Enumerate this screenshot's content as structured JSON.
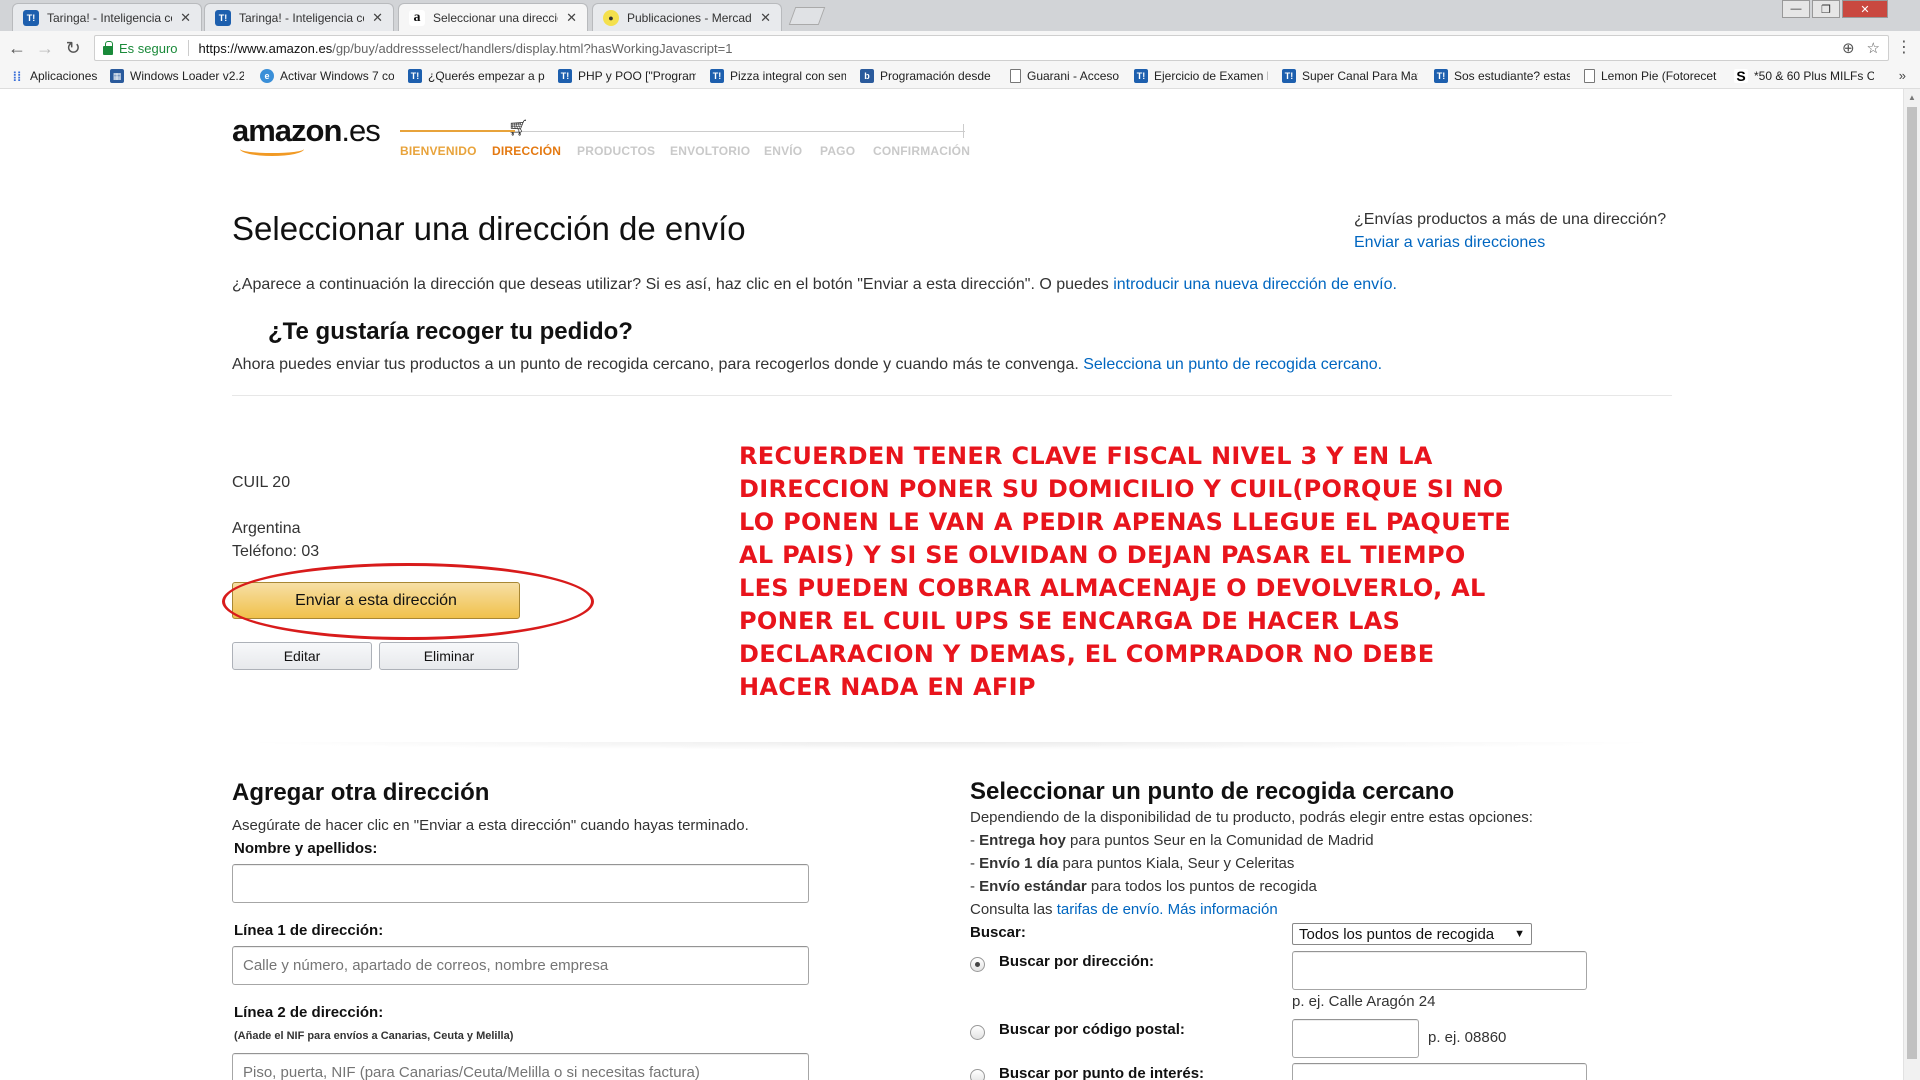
{
  "browser": {
    "tabs": [
      {
        "title": "Taringa! - Inteligencia co",
        "icon": "T!"
      },
      {
        "title": "Taringa! - Inteligencia co",
        "icon": "T!"
      },
      {
        "title": "Seleccionar una dirección",
        "icon": "a"
      },
      {
        "title": "Publicaciones - Mercado",
        "icon": "mercadolibre"
      }
    ],
    "secure_label": "Es seguro",
    "url_host": "https://www.amazon.es",
    "url_path": "/gp/buy/addressselect/handlers/display.html?hasWorkingJavascript=1",
    "bookmarks": [
      "Aplicaciones",
      "Windows Loader v2.2",
      "Activar Windows 7 co",
      "¿Querés empezar a p",
      "PHP y POO [\"Program",
      "Pizza integral con sem",
      "Programación desde",
      "Guarani - Acceso",
      "Ejercicio de Examen F",
      "Super Canal Para Mat",
      "Sos estudiante? estas",
      "Lemon Pie (Fotorecet",
      "*50 & 60 Plus MILFs C"
    ],
    "bookmarks_more": "»"
  },
  "checkout": {
    "logo_text": "amazon",
    "logo_tld": ".es",
    "steps": [
      "BIENVENIDO",
      "DIRECCIÓN",
      "PRODUCTOS",
      "ENVOLTORIO",
      "ENVÍO",
      "PAGO",
      "CONFIRMACIÓN"
    ],
    "accent": "#e47911"
  },
  "main": {
    "title": "Seleccionar una dirección de envío",
    "multi_question": "¿Envías productos a más de una dirección?",
    "multi_link": "Enviar a varias direcciones",
    "intro_text": "¿Aparece a continuación la dirección que deseas utilizar? Si es así, haz clic en el botón \"Enviar a esta dirección\". O puedes ",
    "intro_link": "introducir una nueva dirección de envío.",
    "pickup_heading": "¿Te gustaría recoger tu pedido?",
    "pickup_text": "Ahora puedes enviar tus productos a un punto de recogida cercano, para recogerlos donde y cuando más te convenga. ",
    "pickup_link": "Selecciona un punto de recogida cercano."
  },
  "address": {
    "line1": "CUIL 20",
    "country": "Argentina",
    "phone": "Teléfono: 03",
    "ship_button": "Enviar a esta dirección",
    "edit_button": "Editar",
    "delete_button": "Eliminar"
  },
  "annotation": {
    "text": "RECUERDEN TENER CLAVE FISCAL NIVEL 3 Y EN LA DIRECCION PONER SU DOMICILIO Y CUIL(PORQUE SI NO LO PONEN LE VAN A PEDIR APENAS LLEGUE EL PAQUETE AL PAIS) Y SI SE OLVIDAN O DEJAN PASAR EL TIEMPO LES PUEDEN COBRAR ALMACENAJE O DEVOLVERLO, AL PONER EL CUIL UPS SE ENCARGA DE HACER LAS DECLARACION Y DEMAS, EL COMPRADOR NO DEBE HACER NADA EN AFIP",
    "color": "#e8141c"
  },
  "add_address": {
    "heading": "Agregar otra dirección",
    "subtitle": "Asegúrate de hacer clic en \"Enviar a esta dirección\" cuando hayas terminado.",
    "name_label": "Nombre y apellidos:",
    "name_value": "",
    "line1_label": "Línea 1 de dirección:",
    "line1_placeholder": "Calle y número, apartado de correos, nombre empresa",
    "line2_label": "Línea 2 de dirección:",
    "line2_hint": "(Añade el NIF para envíos a Canarias, Ceuta y Melilla)",
    "line2_placeholder": "Piso, puerta, NIF (para Canarias/Ceuta/Melilla o si necesitas factura)"
  },
  "pickup_point": {
    "heading": "Seleccionar un punto de recogida cercano",
    "desc": "Dependiendo de la disponibilidad de tu producto, podrás elegir entre estas opciones:",
    "options": [
      {
        "bold": "Entrega hoy",
        "rest": " para puntos Seur en la Comunidad de Madrid"
      },
      {
        "bold": "Envío 1 día",
        "rest": " para puntos Kiala, Seur y Celeritas"
      },
      {
        "bold": "Envío estándar",
        "rest": " para todos los puntos de recogida"
      }
    ],
    "consult_prefix": "Consulta las ",
    "rates_link": "tarifas de envío.",
    "more_info_link": "Más información",
    "search_label": "Buscar:",
    "search_select": "Todos los puntos de recogida",
    "by_address": "Buscar por dirección:",
    "address_example": "p. ej. Calle Aragón 24",
    "by_postcode": "Buscar por código postal:",
    "postcode_example": "p. ej. 08860",
    "by_poi": "Buscar por punto de interés:"
  }
}
